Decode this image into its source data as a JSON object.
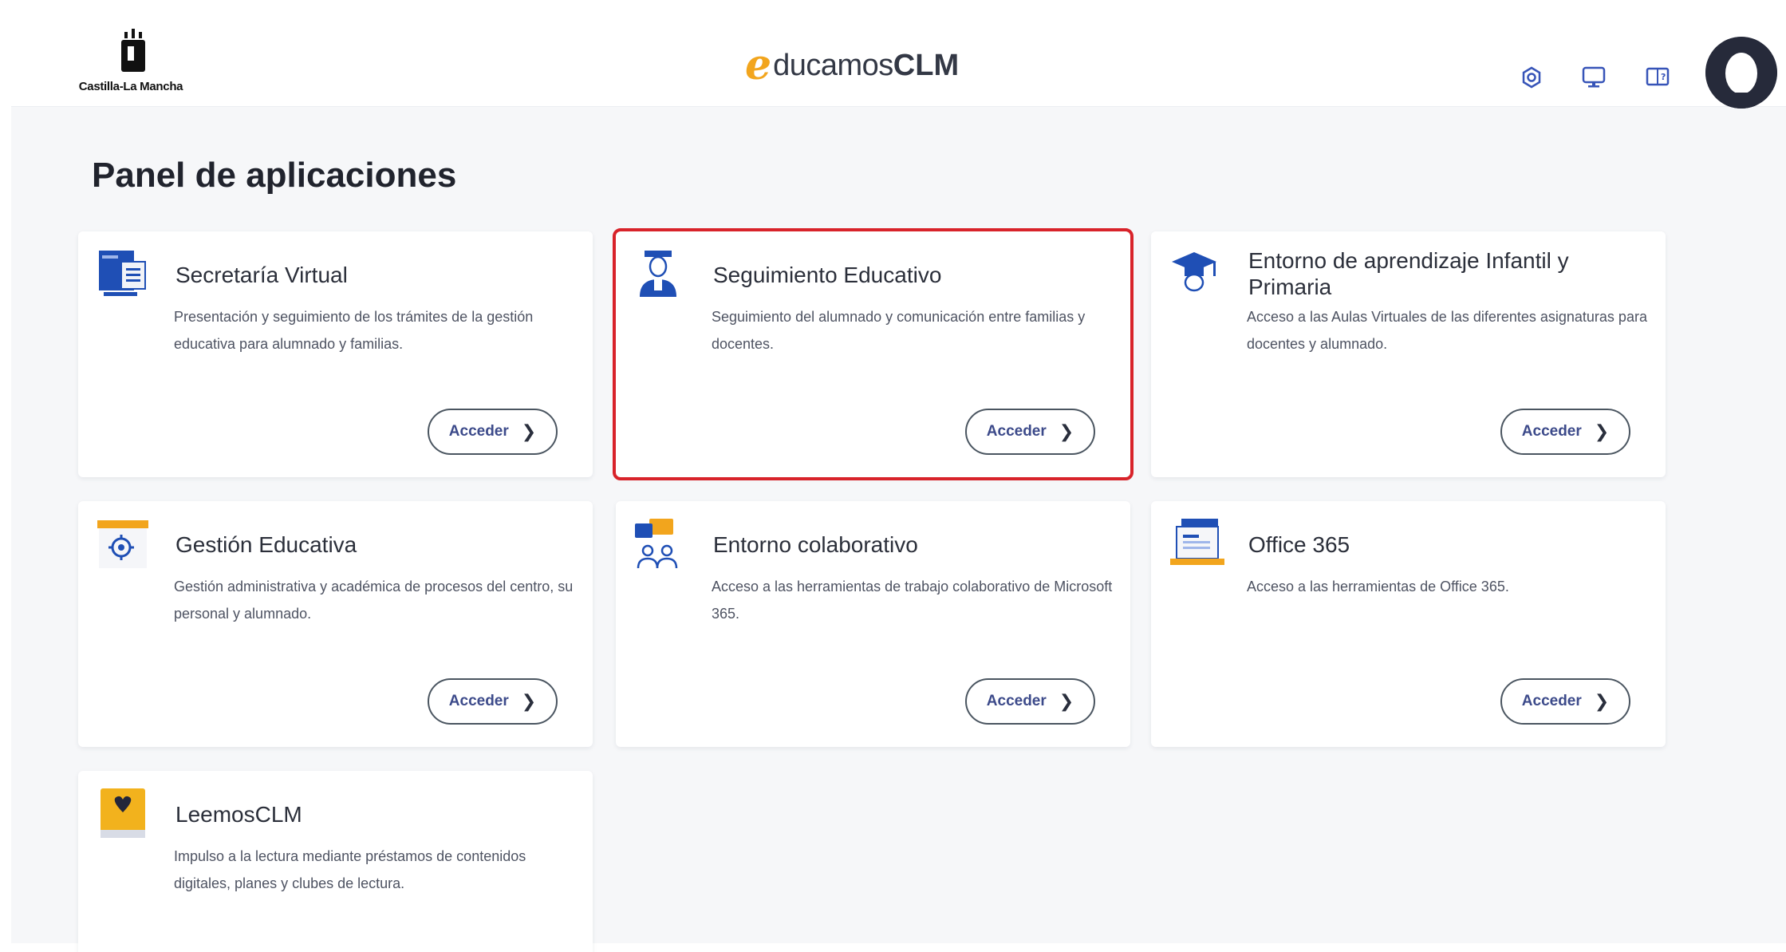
{
  "header": {
    "gov_logo_text": "Castilla-La Mancha",
    "brand_e": "e",
    "brand_word": "ducamos",
    "brand_clm": "CLM",
    "icons": [
      "settings-icon",
      "monitor-icon",
      "help-icon"
    ]
  },
  "page": {
    "title": "Panel de aplicaciones"
  },
  "cards": [
    {
      "title": "Secretaría Virtual",
      "description": "Presentación y seguimiento de los trámites de la gestión educativa para alumnado y familias.",
      "button": "Acceder"
    },
    {
      "title": "Seguimiento Educativo",
      "description": "Seguimiento del alumnado y comunicación entre familias y docentes.",
      "button": "Acceder"
    },
    {
      "title": "Entorno de aprendizaje Infantil y Primaria",
      "description": "Acceso a las Aulas Virtuales de las diferentes asignaturas para docentes y alumnado.",
      "button": "Acceder"
    },
    {
      "title": "Gestión Educativa",
      "description": "Gestión administrativa y académica de procesos del centro, su personal y alumnado.",
      "button": "Acceder"
    },
    {
      "title": "Entorno colaborativo",
      "description": "Acceso a las herramientas de trabajo colaborativo de Microsoft 365.",
      "button": "Acceder"
    },
    {
      "title": "Office 365",
      "description": "Acceso a las herramientas de Office 365.",
      "button": "Acceder"
    },
    {
      "title": "LeemosCLM",
      "description": "Impulso a la lectura mediante préstamos de contenidos digitales, planes y clubes de lectura.",
      "button": ""
    }
  ],
  "colors": {
    "accent": "#f2a51d",
    "selection": "#d8232a",
    "button_text": "#3c4a8a",
    "icon_blue": "#1f4fb5"
  }
}
